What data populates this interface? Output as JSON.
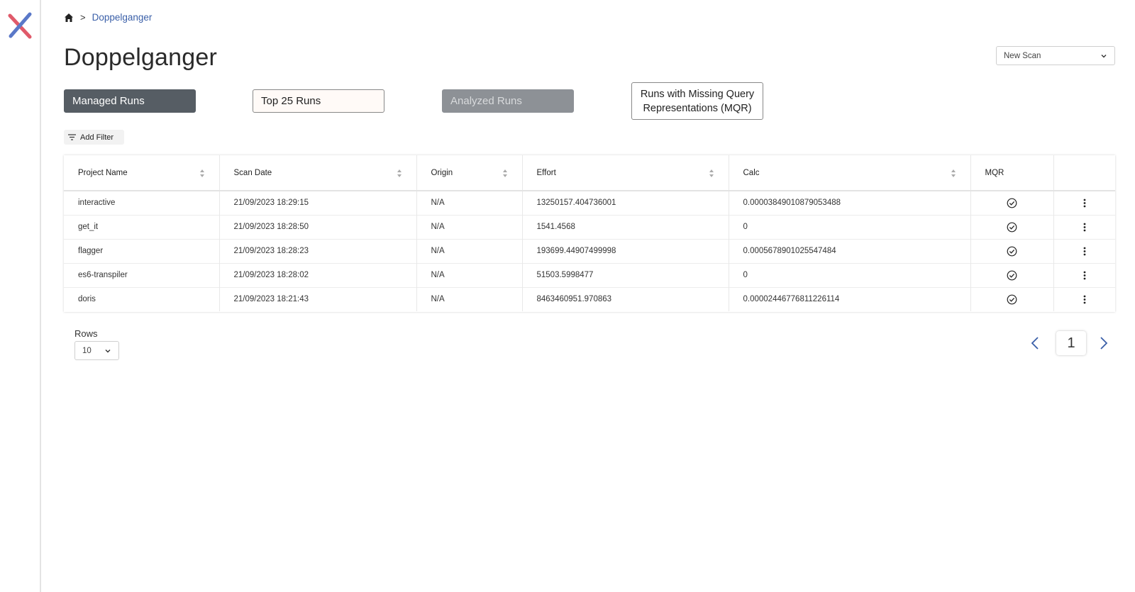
{
  "colors": {
    "accent_blue": "#3a5fa8",
    "logo_red": "#e05a6a",
    "logo_blue": "#5a78c8",
    "tab_active": "#565d64",
    "tab_disabled": "#8d9196"
  },
  "breadcrumb": {
    "home_icon": "home-icon",
    "separator": ">",
    "current": "Doppelganger"
  },
  "page": {
    "title": "Doppelganger"
  },
  "new_scan": {
    "label": "New Scan"
  },
  "tabs": [
    {
      "label": "Managed Runs",
      "state": "active"
    },
    {
      "label": "Top 25 Runs",
      "state": "default"
    },
    {
      "label": "Analyzed Runs",
      "state": "disabled"
    },
    {
      "label": "Runs with Missing Query Representations (MQR)",
      "state": "default"
    }
  ],
  "filter": {
    "label": "Add Filter"
  },
  "table": {
    "columns": [
      "Project Name",
      "Scan Date",
      "Origin",
      "Effort",
      "Calc",
      "MQR"
    ],
    "rows": [
      {
        "project": "interactive",
        "date": "21/09/2023 18:29:15",
        "origin": "N/A",
        "effort": "13250157.404736001",
        "calc": "0.000038490108790534​88",
        "mqr": true
      },
      {
        "project": "get_it",
        "date": "21/09/2023 18:28:50",
        "origin": "N/A",
        "effort": "1541.4568",
        "calc": "0",
        "mqr": true
      },
      {
        "project": "flagger",
        "date": "21/09/2023 18:28:23",
        "origin": "N/A",
        "effort": "193699.44907499998",
        "calc": "0.0005678901025547484",
        "mqr": true
      },
      {
        "project": "es6-transpiler",
        "date": "21/09/2023 18:28:02",
        "origin": "N/A",
        "effort": "51503.5998477",
        "calc": "0",
        "mqr": true
      },
      {
        "project": "doris",
        "date": "21/09/2023 18:21:43",
        "origin": "N/A",
        "effort": "8463460951.970863",
        "calc": "0.00002446776811226114",
        "mqr": true
      }
    ]
  },
  "pagination": {
    "rows_label": "Rows",
    "rows_per_page": "10",
    "current_page": "1"
  }
}
